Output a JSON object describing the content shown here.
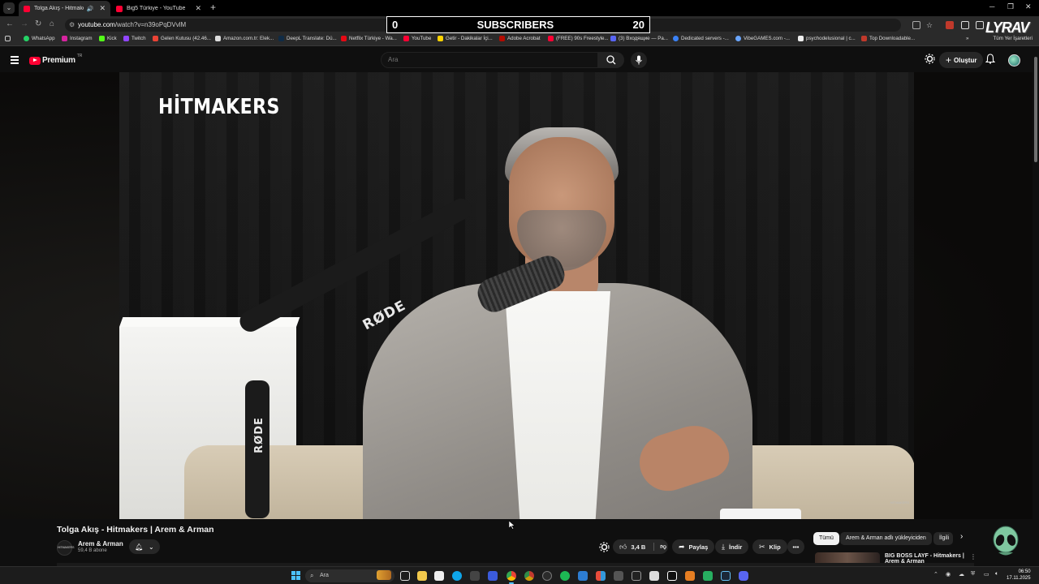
{
  "browser": {
    "tabs": [
      {
        "title": "Tolga Akış - Hitmakers | Arem & Arman",
        "active": true
      },
      {
        "title": "Big5 Türkiye - YouTube",
        "active": false
      }
    ],
    "url_domain": "youtube.com",
    "url_path": "/watch?v=n39oPqDVvlM",
    "bookmarks": [
      "WhatsApp",
      "Instagram",
      "Kick",
      "Twitch",
      "Gelen Kutusu (42.46...",
      "Amazon.com.tr: Elek...",
      "DeepL Translate: Dü...",
      "Netflix Türkiye - Wa...",
      "YouTube",
      "Getir - Dakikalar İçi...",
      "Adobe Acrobat",
      "(FREE) 90s Freestyle...",
      "(3) Входящие — Pa...",
      "Dedicated servers -...",
      "VibeGAMES.com -...",
      "psychodelusional | c...",
      "Top Downloadable..."
    ],
    "all_bookmarks": "Tüm Yer İşaretleri"
  },
  "overlay": {
    "subscriber_current": "0",
    "subscriber_label": "SUBSCRIBERS",
    "subscriber_goal": "20",
    "streamer_logo": "LYRAV"
  },
  "youtube": {
    "logo_text": "Premium",
    "region": "TR",
    "search_placeholder": "Ara",
    "create_label": "Oluştur",
    "video": {
      "brand_overlay": "HİTMAKERS",
      "corner_mark": "HITMAKERS",
      "mic_brand": "RØDE",
      "title": "Tolga Akış - Hitmakers | Arem & Arman",
      "channel_avatar_text": "HITMAKERS",
      "channel_name": "Arem & Arman",
      "subscribers": "59,4 B abone",
      "likes": "3,4 B",
      "share_label": "Paylaş",
      "download_label": "İndir",
      "clip_label": "Klip"
    },
    "chips": [
      "Tümü",
      "Arem & Arman adlı yükleyiciden",
      "İlgili"
    ],
    "recommended": {
      "title": "BIG BOSS LAYF - Hitmakers |",
      "title_line2": "Arem & Arman"
    }
  },
  "taskbar": {
    "search_placeholder": "Ara",
    "time": "06:50",
    "date": "17.11.2025"
  }
}
